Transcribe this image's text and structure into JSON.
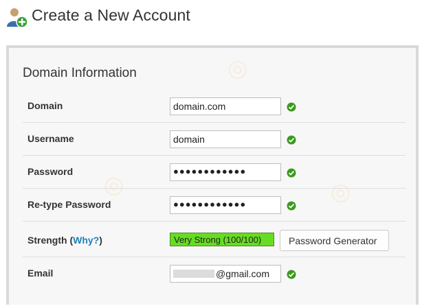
{
  "page": {
    "title": "Create a New Account"
  },
  "section": {
    "title": "Domain Information"
  },
  "fields": {
    "domain": {
      "label": "Domain",
      "value": "domain.com"
    },
    "username": {
      "label": "Username",
      "value": "domain"
    },
    "password": {
      "label": "Password",
      "value": "●●●●●●●●●●●●"
    },
    "retype": {
      "label": "Re-type Password",
      "value": "●●●●●●●●●●●●"
    },
    "strength": {
      "label": "Strength (",
      "why": "Why?",
      "label_end": ")",
      "value": "Very Strong (100/100)",
      "meter_color": "#66dd22",
      "generator_label": "Password Generator"
    },
    "email": {
      "label": "Email",
      "value_suffix": "@gmail.com"
    }
  },
  "icons": {
    "header": "user-add-icon",
    "valid": "check-circle-icon"
  },
  "colors": {
    "link": "#1f7fb8",
    "valid": "#3a9a1e",
    "panel_border": "#d9d9d9"
  }
}
